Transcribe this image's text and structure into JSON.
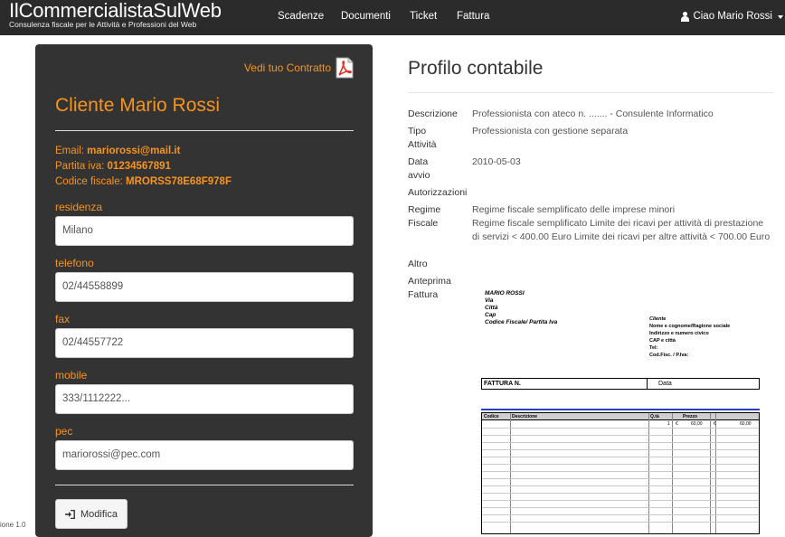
{
  "navbar": {
    "brand_name": "IlCommercialistaSulWeb",
    "brand_tagline": "Consulenza fiscale per le Attività e Professioni del Web",
    "items": [
      "Scadenze",
      "Documenti",
      "Ticket",
      "Fattura"
    ],
    "user_label": "Ciao Mario Rossi"
  },
  "client": {
    "contract_link": "Vedi tuo Contratto",
    "title": "Cliente Mario Rossi",
    "email_label": "Email:",
    "email": "mariorossi@mail.it",
    "piva_label": "Partita iva:",
    "piva": "01234567891",
    "cf_label": "Codice fiscale:",
    "cf": "MRORSS78E68F978F",
    "fields": [
      {
        "label": "residenza",
        "value": "Milano"
      },
      {
        "label": "telefono",
        "value": "02/44558899"
      },
      {
        "label": "fax",
        "value": "02/44557722"
      },
      {
        "label": "mobile",
        "value": "333/1112222..."
      },
      {
        "label": "pec",
        "value": "mariorossi@pec.com"
      }
    ],
    "edit_button": "Modifica"
  },
  "footer": {
    "version_text": "ione 1.0"
  },
  "profile": {
    "title": "Profilo contabile",
    "descrizione_label": "Descrizione",
    "descrizione": "Professionista con ateco n. ....... - Consulente Informatico",
    "tipo_label_1": "Tipo",
    "tipo_label_2": "Attività",
    "tipo": "Professionista con gestione separata",
    "data_label_1": "Data",
    "data_label_2": "avvio",
    "data": "2010-05-03",
    "autorizzazioni_label": "Autorizzazioni",
    "regime_label_1": "Regime",
    "regime_label_2": "Fiscale",
    "regime_1": "Regime fiscale semplificato delle imprese minori",
    "regime_2": "Regime fiscale semplificato Limite dei ricavi per attività di prestazione di servizi < 400.00 Euro Limite dei ricavi per altre attività < 700.00 Euro",
    "altro_label": "Altro",
    "anteprima_label_1": "Anteprima",
    "anteprima_label_2": "Fattura"
  },
  "invoice": {
    "sender": [
      "MARIO ROSSI",
      "Via",
      "Città",
      "Cap",
      "Codice Fiscale/ Partita Iva"
    ],
    "client_title": "Cliente",
    "client_lines": [
      "Nome e cognome/Ragione sociale",
      "Indirizzo e numero civico",
      "CAP e città",
      "Tel:",
      "Cod.Fisc. / P.Iva:"
    ],
    "fattura_label": "FATTURA  N.",
    "data_label": "Data",
    "headers": [
      "Codice",
      "Descrizione",
      "Q.tà",
      "Prezzo"
    ],
    "row1": {
      "qty": "1",
      "cur1": "€",
      "price": "60,00",
      "cur2": "€",
      "total": "60,00"
    }
  },
  "colors": {
    "accent": "#f7941d",
    "navbar": "#2b2b2b",
    "panel": "#333333"
  }
}
